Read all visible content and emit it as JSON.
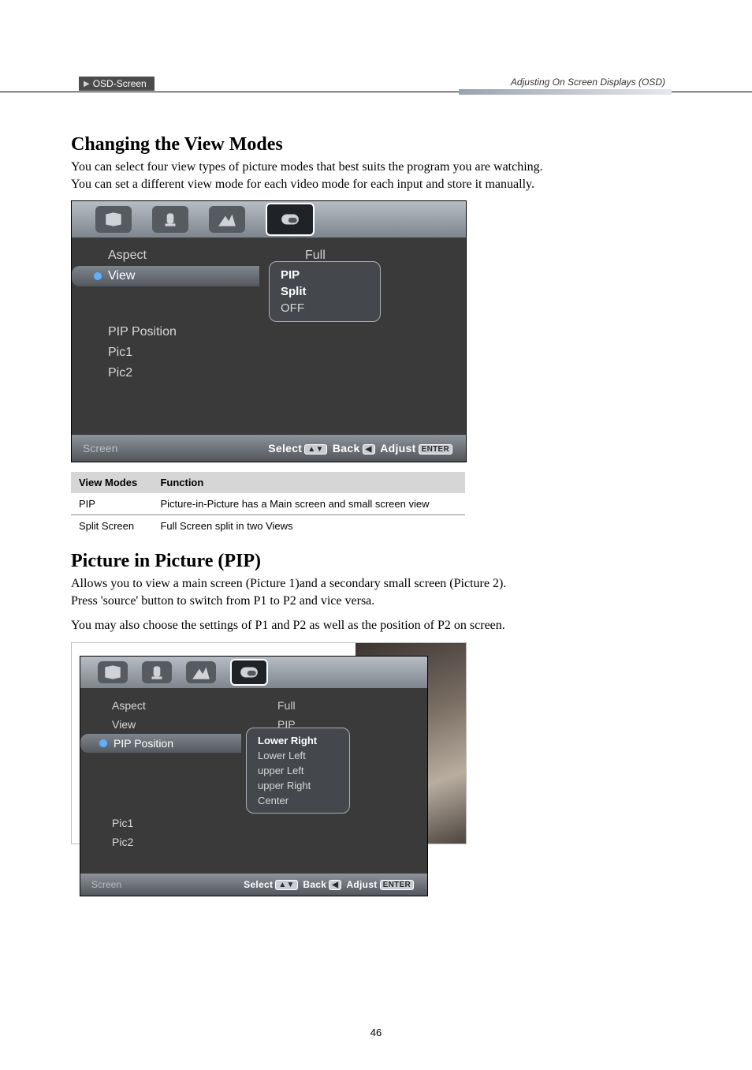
{
  "header": {
    "breadcrumb": "OSD-Screen",
    "right": "Adjusting On Screen Displays (OSD)"
  },
  "section1": {
    "title": "Changing the View Modes",
    "para": "You can select four view types of picture modes that best suits the program you are watching. You can set a different view mode for each video mode for each input and store it manually."
  },
  "osd1": {
    "items": {
      "aspect_label": "Aspect",
      "aspect_value": "Full",
      "view_label": "View",
      "pip_position_label": "PIP Position",
      "pic1_label": "Pic1",
      "pic2_label": "Pic2"
    },
    "popup": {
      "opt1": "PIP",
      "opt2": "Split",
      "opt3": "OFF"
    },
    "footer_title": "Screen",
    "footer_select": "Select",
    "footer_back": "Back",
    "footer_adjust": "Adjust",
    "footer_enter": "ENTER"
  },
  "table": {
    "h1": "View Modes",
    "h2": "Function",
    "r1c1": "PIP",
    "r1c2": "Picture-in-Picture has  a Main screen and small screen view",
    "r2c1": "Split Screen",
    "r2c2": "Full Screen split in two Views"
  },
  "section2": {
    "title": "Picture in Picture (PIP)",
    "para1": "Allows you to view a main screen (Picture 1)and a secondary small screen (Picture 2).",
    "para2": "Press 'source' button to switch from P1 to P2 and vice versa.",
    "para3": "You may also choose the settings of P1 and P2 as well as the position of P2 on screen."
  },
  "osd2": {
    "items": {
      "aspect_label": "Aspect",
      "aspect_value": "Full",
      "view_label": "View",
      "view_value": "PIP",
      "pip_position_label": "PIP Position",
      "pic1_label": "Pic1",
      "pic2_label": "Pic2"
    },
    "popup": {
      "opt1": "Lower Right",
      "opt2": "Lower Left",
      "opt3": "upper Left",
      "opt4": "upper Right",
      "opt5": "Center"
    },
    "footer_title": "Screen",
    "footer_select": "Select",
    "footer_back": "Back",
    "footer_adjust": "Adjust",
    "footer_enter": "ENTER"
  },
  "page_number": "46"
}
